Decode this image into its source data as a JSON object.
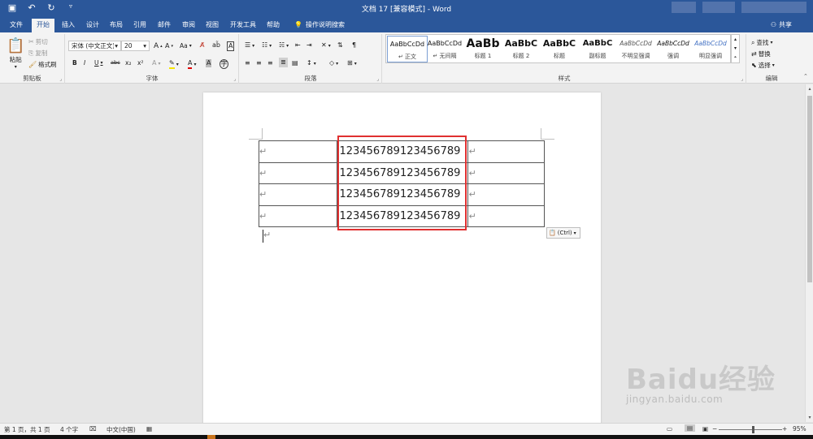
{
  "titlebar": {
    "title": "文档 17 [兼容模式] - Word",
    "qat": {
      "save_icon": "save-icon",
      "undo_icon": "undo-icon",
      "redo_icon": "redo-icon",
      "customize_icon": "customize-qat-icon"
    }
  },
  "tabs": [
    "文件",
    "开始",
    "插入",
    "设计",
    "布局",
    "引用",
    "邮件",
    "审阅",
    "视图",
    "开发工具",
    "帮助"
  ],
  "active_tab": "开始",
  "tell_me": "操作说明搜索",
  "share": "共享",
  "clipboard": {
    "paste": "粘贴",
    "cut": "剪切",
    "copy": "复制",
    "format_painter": "格式刷",
    "label": "剪贴板"
  },
  "font": {
    "name": "宋体 (中文正文)",
    "size": "20",
    "grow": "A",
    "shrink": "A",
    "case": "Aa",
    "bold": "B",
    "italic": "I",
    "underline": "U",
    "strike": "abc",
    "subscript": "x₂",
    "superscript": "x²",
    "label": "字体"
  },
  "paragraph": {
    "label": "段落"
  },
  "styles": {
    "label": "样式",
    "items": [
      {
        "sample": "AaBbCcDd",
        "name": "↵ 正文"
      },
      {
        "sample": "AaBbCcDd",
        "name": "↵ 无间隔"
      },
      {
        "sample": "AaBb",
        "name": "标题 1"
      },
      {
        "sample": "AaBbC",
        "name": "标题 2"
      },
      {
        "sample": "AaBbC",
        "name": "标题"
      },
      {
        "sample": "AaBbC",
        "name": "副标题"
      },
      {
        "sample": "AaBbCcDd",
        "name": "不明显强调"
      },
      {
        "sample": "AaBbCcDd",
        "name": "强调"
      },
      {
        "sample": "AaBbCcDd",
        "name": "明显强调"
      }
    ]
  },
  "editing": {
    "find": "查找",
    "replace": "替换",
    "select": "选择",
    "label": "编辑"
  },
  "document": {
    "table_rows": [
      [
        "↵",
        "123456789123456789",
        "↵"
      ],
      [
        "↵",
        "123456789123456789",
        "↵"
      ],
      [
        "↵",
        "123456789123456789",
        "↵"
      ],
      [
        "↵",
        "123456789123456789",
        "↵"
      ]
    ],
    "after_table_mark": "↵",
    "paste_options": "(Ctrl)"
  },
  "statusbar": {
    "page": "第 1 页，共 1 页",
    "words": "4 个字",
    "language": "中文(中国)",
    "zoom": "95%"
  },
  "watermark": {
    "brand": "Baidu经验",
    "url": "jingyan.baidu.com"
  },
  "colors": {
    "titlebar": "#2b579a",
    "highlight_box": "#e03030"
  }
}
